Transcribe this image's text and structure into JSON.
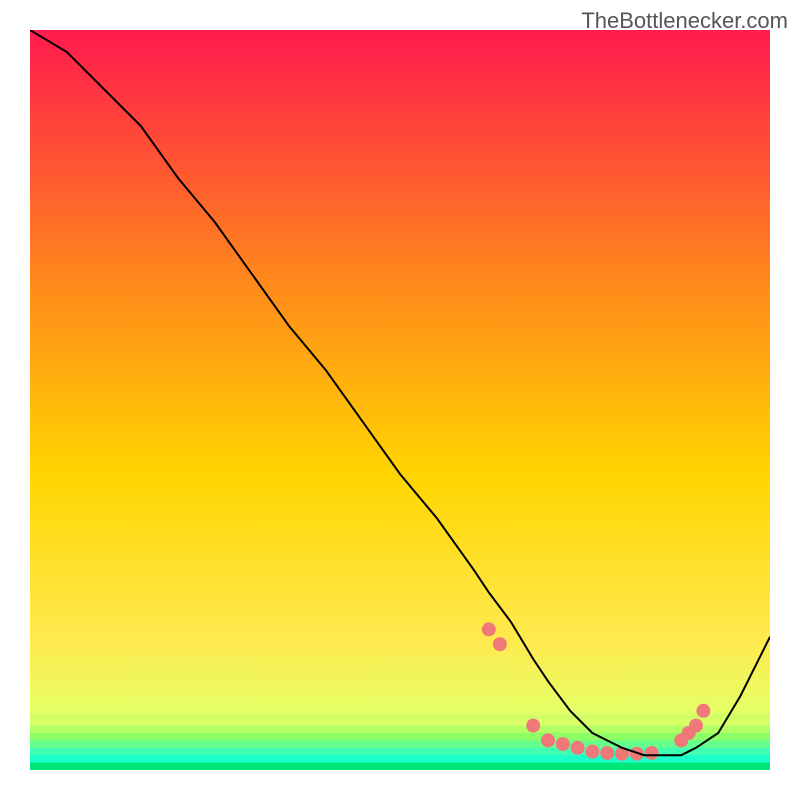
{
  "watermark": "TheBottlenecker.com",
  "chart_data": {
    "type": "line",
    "title": "",
    "xlabel": "",
    "ylabel": "",
    "xlim": [
      0,
      100
    ],
    "ylim": [
      0,
      100
    ],
    "gradient": {
      "top_color": "#ff1a4d",
      "mid_color": "#ffd500",
      "low_color": "#e6ff66",
      "bottom_color": "#00e676"
    },
    "series": [
      {
        "name": "curve",
        "color": "#000000",
        "stroke_width": 2,
        "x": [
          0,
          5,
          10,
          15,
          20,
          25,
          30,
          35,
          40,
          45,
          50,
          55,
          60,
          62,
          65,
          68,
          70,
          73,
          76,
          80,
          83,
          85,
          88,
          90,
          93,
          96,
          100
        ],
        "y": [
          100,
          97,
          92,
          87,
          80,
          74,
          67,
          60,
          54,
          47,
          40,
          34,
          27,
          24,
          20,
          15,
          12,
          8,
          5,
          3,
          2,
          2,
          2,
          3,
          5,
          10,
          18
        ]
      }
    ],
    "highlight_points": {
      "color": "#f07878",
      "radius": 7,
      "x": [
        62,
        63.5,
        68,
        70,
        72,
        74,
        76,
        78,
        80,
        82,
        84,
        88,
        89,
        90,
        91
      ],
      "y": [
        19,
        17,
        6,
        4,
        3.5,
        3,
        2.5,
        2.3,
        2.2,
        2.2,
        2.3,
        4,
        5,
        6,
        8
      ]
    }
  }
}
